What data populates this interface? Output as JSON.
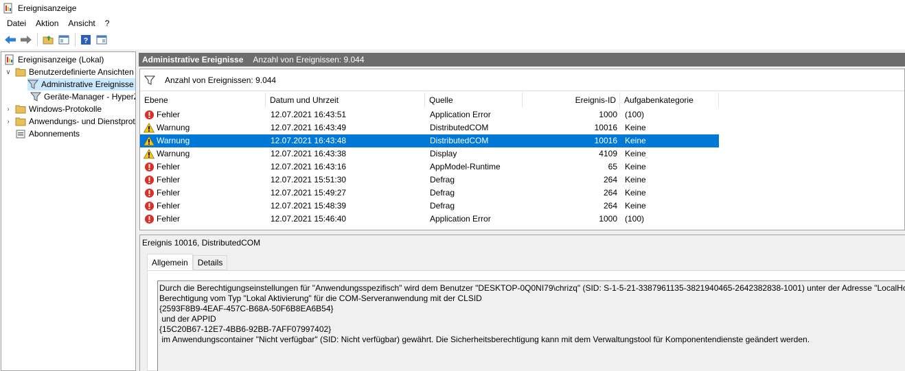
{
  "window": {
    "title": "Ereignisanzeige"
  },
  "menu": [
    "Datei",
    "Aktion",
    "Ansicht",
    "?"
  ],
  "toolbar": {
    "icons": [
      "back-arrow-icon",
      "forward-arrow-icon",
      "folder-up-icon",
      "show-hide-tree-icon",
      "help-icon",
      "action-pane-icon"
    ]
  },
  "tree": {
    "root": "Ereignisanzeige (Lokal)",
    "custom_views": "Benutzerdefinierte Ansichten",
    "admin_events": "Administrative Ereignisse",
    "device_manager": "Geräte-Manager - HyperZ",
    "windows_logs": "Windows-Protokolle",
    "app_service_logs": "Anwendungs- und Dienstprotokolle",
    "subscriptions": "Abonnements"
  },
  "header": {
    "title": "Administrative Ereignisse",
    "count": "Anzahl von Ereignissen: 9.044"
  },
  "filter": {
    "count": "Anzahl von Ereignissen: 9.044"
  },
  "columns": {
    "level": "Ebene",
    "datetime": "Datum und Uhrzeit",
    "source": "Quelle",
    "event_id": "Ereignis-ID",
    "category": "Aufgabenkategorie"
  },
  "events": [
    {
      "type": "error",
      "level": "Fehler",
      "datetime": "12.07.2021 16:43:51",
      "source": "Application Error",
      "id": "1000",
      "category": "(100)"
    },
    {
      "type": "warning",
      "level": "Warnung",
      "datetime": "12.07.2021 16:43:49",
      "source": "DistributedCOM",
      "id": "10016",
      "category": "Keine"
    },
    {
      "type": "warning",
      "level": "Warnung",
      "datetime": "12.07.2021 16:43:48",
      "source": "DistributedCOM",
      "id": "10016",
      "category": "Keine",
      "selected": true
    },
    {
      "type": "warning",
      "level": "Warnung",
      "datetime": "12.07.2021 16:43:38",
      "source": "Display",
      "id": "4109",
      "category": "Keine"
    },
    {
      "type": "error",
      "level": "Fehler",
      "datetime": "12.07.2021 16:43:16",
      "source": "AppModel-Runtime",
      "id": "65",
      "category": "Keine"
    },
    {
      "type": "error",
      "level": "Fehler",
      "datetime": "12.07.2021 15:51:30",
      "source": "Defrag",
      "id": "264",
      "category": "Keine"
    },
    {
      "type": "error",
      "level": "Fehler",
      "datetime": "12.07.2021 15:49:27",
      "source": "Defrag",
      "id": "264",
      "category": "Keine"
    },
    {
      "type": "error",
      "level": "Fehler",
      "datetime": "12.07.2021 15:48:39",
      "source": "Defrag",
      "id": "264",
      "category": "Keine"
    },
    {
      "type": "error",
      "level": "Fehler",
      "datetime": "12.07.2021 15:46:40",
      "source": "Application Error",
      "id": "1000",
      "category": "(100)"
    }
  ],
  "detail": {
    "header": "Ereignis 10016, DistributedCOM",
    "tabs": [
      "Allgemein",
      "Details"
    ],
    "description": [
      "Durch die Berechtigungseinstellungen für \"Anwendungsspezifisch\" wird dem Benutzer \"DESKTOP-0Q0NI79\\chrizq\" (SID: S-1-5-21-3387961135-3821940465-2642382838-1001) unter der Adresse \"LocalHost (unt",
      "Berechtigung vom Typ \"Lokal Aktivierung\" für die COM-Serveranwendung mit der CLSID",
      "{2593F8B9-4EAF-457C-B68A-50F6B8EA6B54}",
      " und der APPID",
      "{15C20B67-12E7-4BB6-92BB-7AFF07997402}",
      " im Anwendungscontainer \"Nicht verfügbar\" (SID: Nicht verfügbar) gewährt. Die Sicherheitsberechtigung kann mit dem Verwaltungstool für Komponentendienste geändert werden."
    ]
  },
  "colors": {
    "selection": "#0078d7",
    "header_bar": "#6d6d6d",
    "error": "#d7312a",
    "warning": "#f4c81b"
  }
}
